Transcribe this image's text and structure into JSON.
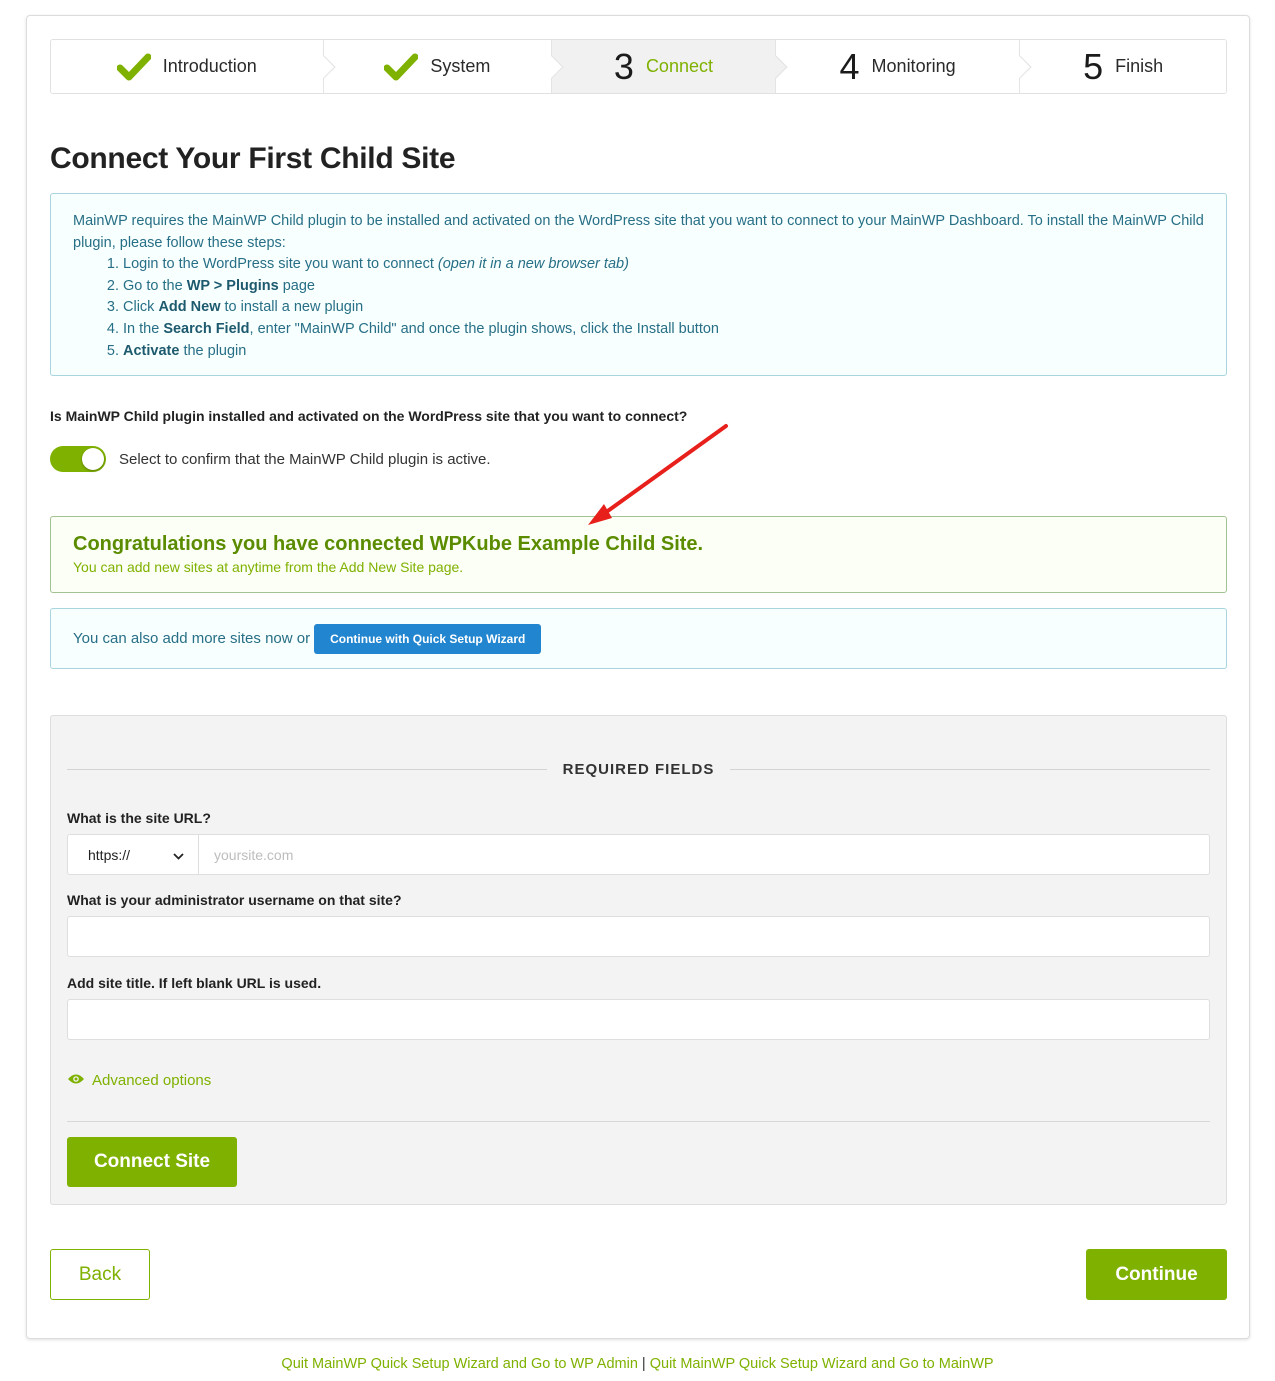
{
  "steps": [
    {
      "label": "Introduction",
      "state": "done",
      "icon": "check-icon"
    },
    {
      "label": "System",
      "state": "done",
      "icon": "check-icon"
    },
    {
      "label": "Connect",
      "number": "3",
      "state": "active"
    },
    {
      "label": "Monitoring",
      "number": "4",
      "state": "pending"
    },
    {
      "label": "Finish",
      "number": "5",
      "state": "pending"
    }
  ],
  "page_title": "Connect Your First Child Site",
  "info": {
    "intro": "MainWP requires the MainWP Child plugin to be installed and activated on the WordPress site that you want to connect to your MainWP Dashboard. To install the MainWP Child plugin, please follow these steps:",
    "step1_text": "Login to the WordPress site you want to connect ",
    "step1_italic": "(open it in a new browser tab)",
    "step2_pre": "Go to the ",
    "step2_bold": "WP > Plugins",
    "step2_post": " page",
    "step3_pre": "Click ",
    "step3_bold": "Add New",
    "step3_post": " to install a new plugin",
    "step4_pre": "In the ",
    "step4_bold": "Search Field",
    "step4_post": ", enter \"MainWP Child\" and once the plugin shows, click the Install button",
    "step5_bold": "Activate",
    "step5_post": " the plugin"
  },
  "question": "Is MainWP Child plugin installed and activated on the WordPress site that you want to connect?",
  "toggle": {
    "label": "Select to confirm that the MainWP Child plugin is active.",
    "checked": true
  },
  "success": {
    "title": "Congratulations you have connected WPKube Example Child Site.",
    "subtitle": "You can add new sites at anytime from the Add New Site page."
  },
  "more": {
    "text": "You can also add more sites now or",
    "button": "Continue with Quick Setup Wizard"
  },
  "form": {
    "section_title": "REQUIRED FIELDS",
    "url_label": "What is the site URL?",
    "protocol": "https://",
    "url_placeholder": "yoursite.com",
    "username_label": "What is your administrator username on that site?",
    "title_label": "Add site title. If left blank URL is used.",
    "advanced": "Advanced options",
    "connect_button": "Connect Site"
  },
  "nav": {
    "back": "Back",
    "continue": "Continue"
  },
  "footer": {
    "link1": "Quit MainWP Quick Setup Wizard and Go to WP Admin",
    "separator": "|",
    "link2": "Quit MainWP Quick Setup Wizard and Go to MainWP"
  },
  "colors": {
    "accent_green": "#7fb100",
    "info_blue": "#276f86",
    "button_blue": "#2185d0"
  }
}
